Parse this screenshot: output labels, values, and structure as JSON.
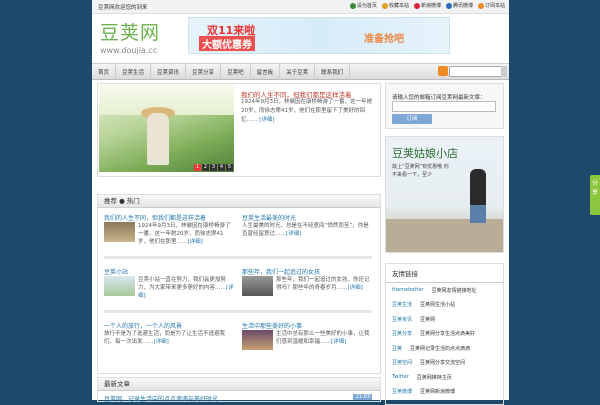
{
  "topbar": {
    "left_text": "豆荚网欢迎您的到来",
    "links": [
      {
        "label": "设为首页",
        "icon": "home-icon",
        "color": "#3a8a3a"
      },
      {
        "label": "收藏本站",
        "icon": "star-icon",
        "color": "#e0a020"
      },
      {
        "label": "新浪微博",
        "icon": "weibo-icon",
        "color": "#d23"
      },
      {
        "label": "腾讯微博",
        "icon": "qq-icon",
        "color": "#2a6ab8"
      },
      {
        "label": "订阅本站",
        "icon": "rss-icon",
        "color": "#f08a24"
      }
    ]
  },
  "logo": {
    "cn": "豆荚网",
    "en": "www.doujia.cc"
  },
  "banner": {
    "line1": "双11来啦",
    "line2": "大额优惠券",
    "line3": "准备抢吧"
  },
  "nav": {
    "items": [
      "首页",
      "豆荚生活",
      "豆荚资讯",
      "豆荚分享",
      "豆荚吧",
      "留言板",
      "关于豆荚",
      "联系我们"
    ]
  },
  "featured": {
    "title": "我们的人生不同，但我们都是这样活着",
    "excerpt": "1924年9月3日，林徽因在康桥畅游了一番，这一年她20岁，而徐志摩41岁，他们在那里留下了美好的回忆……",
    "more": "[详细]",
    "slides": [
      "1",
      "2",
      "3",
      "4",
      "5"
    ]
  },
  "section1": {
    "heading": "推荐 ● 热门",
    "cells": [
      {
        "title": "我们的人生不同，但我们都是这样活着",
        "excerpt": "1924年9月3日，林徽因在康桥畅游了一番，这一年她20岁，而徐志摩41岁，他们在那里……",
        "more": "[详细]"
      },
      {
        "title": "豆荚生活最美的时光",
        "excerpt": "人生最美的时光，总是在不经意间“悄然而至”，你是否曾经留意过……",
        "more": "[详细]"
      },
      {
        "title": "豆荚小站",
        "excerpt": "豆荚小站一直在努力，我们会更加努力，为大家带来更多更好的内容……",
        "more": "[详细]"
      },
      {
        "title": "那些年，我们一起追过的女孩",
        "excerpt": "那些年，我们一起追过的女孩，你还记得吗？那些年的青春岁月……",
        "more": "[详细]"
      },
      {
        "title": "一个人的旅行，一个人的风景",
        "excerpt": "旅行不是为了逃避生活，而是为了让生活不逃避我们，每一次出发……",
        "more": "[详细]"
      },
      {
        "title": "生活中那些美好的小事",
        "excerpt": "生活中总有那么一些美好的小事，让我们感到温暖和幸福……",
        "more": "[详细]"
      }
    ]
  },
  "section2": {
    "heading": "最新文章",
    "item": "豆荚网，记录生活中的点点滴滴与美好时光",
    "date": "11-03"
  },
  "login": {
    "title": "请输入您的邮箱订阅豆荚网最新文章：",
    "button": "订阅"
  },
  "shop_ad": {
    "title": "豆荚姑娘小店",
    "text": "敲上“豆荚网”有优惠哦 你不来看一下，至少"
  },
  "links_box": {
    "heading": "友情链接",
    "rows": [
      {
        "k": "themebetter",
        "v": "豆荚网友情链接地址"
      },
      {
        "k": "豆荚生活",
        "v": "豆荚网生活小站"
      },
      {
        "k": "豆荚资讯",
        "v": "豆荚网"
      },
      {
        "k": "豆荚分享",
        "v": "豆荚网分享生活点滴美好"
      },
      {
        "k": "豆荚",
        "v": "豆荚网记录生活的点点滴滴"
      },
      {
        "k": "豆荚空间",
        "v": "豆荚网分享交流空间"
      },
      {
        "k": "Twitter",
        "v": "豆荚网推特主页"
      },
      {
        "k": "豆荚微博",
        "v": "豆荚网新浪微博"
      }
    ]
  },
  "share": {
    "label": "分享"
  }
}
